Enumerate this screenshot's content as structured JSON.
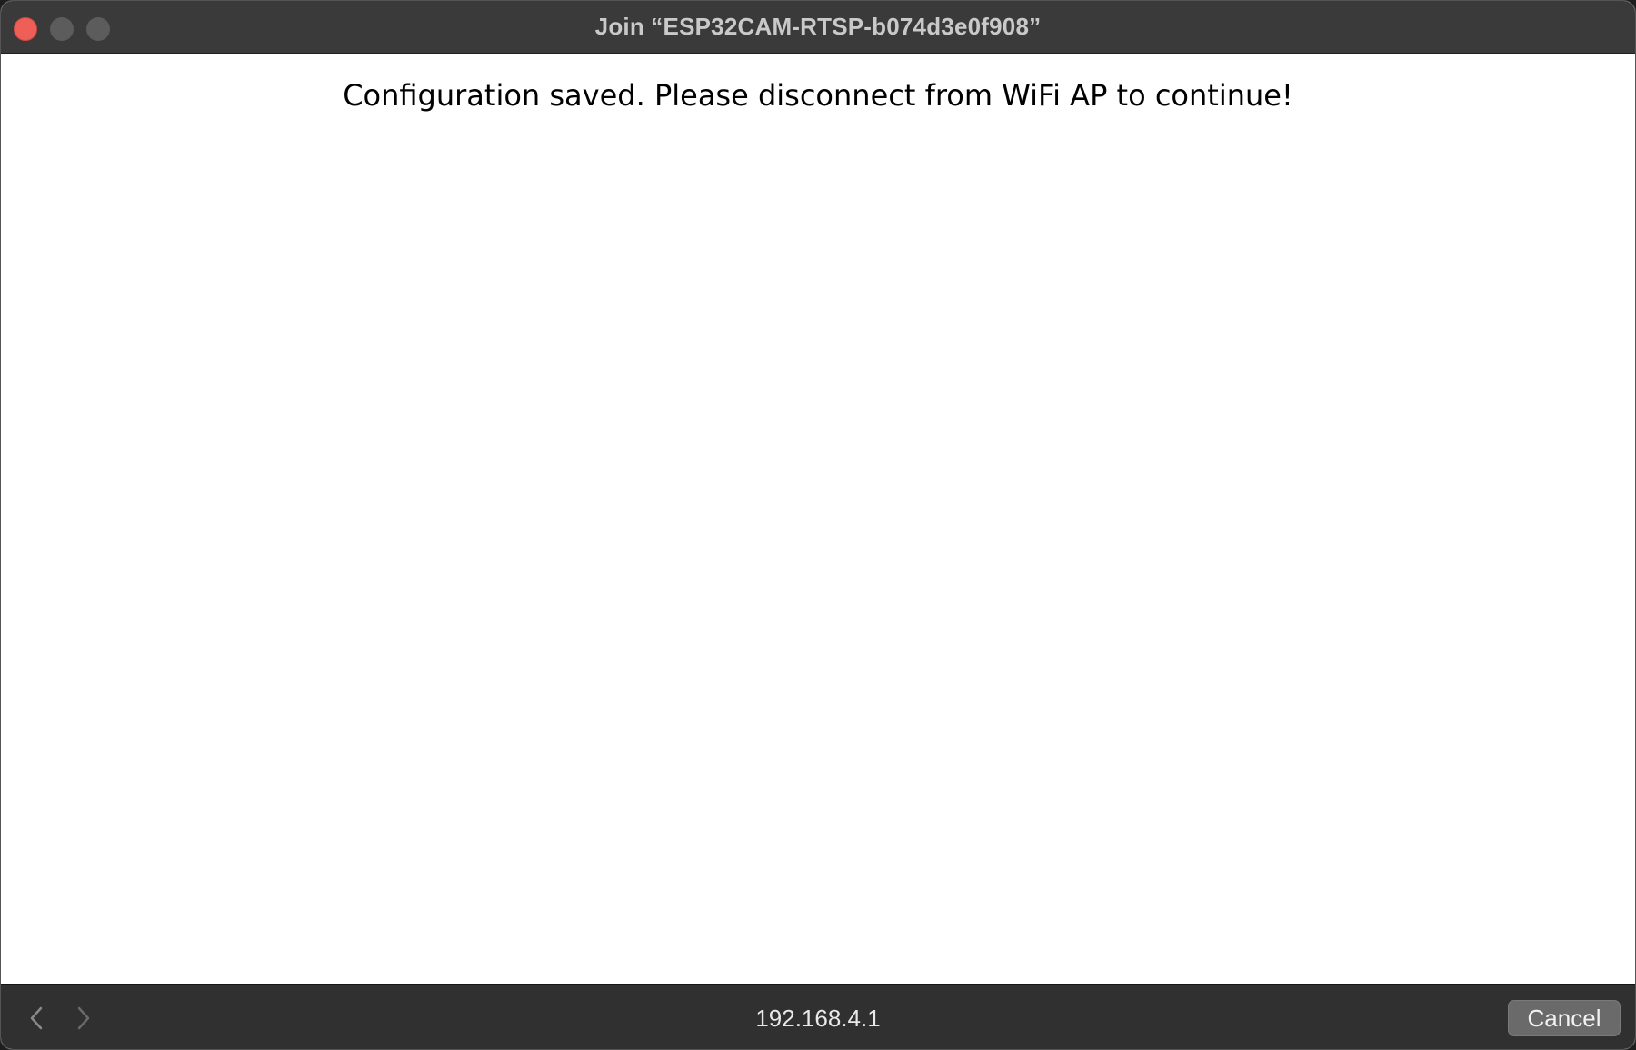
{
  "window": {
    "title": "Join “ESP32CAM-RTSP-b074d3e0f908”"
  },
  "content": {
    "message": "Configuration saved. Please disconnect from WiFi AP to continue!"
  },
  "bottombar": {
    "url": "192.168.4.1",
    "cancel_label": "Cancel"
  },
  "icons": {
    "back": "chevron-left-icon",
    "forward": "chevron-right-icon"
  },
  "colors": {
    "close_button": "#ee5f57",
    "titlebar": "#3a3a3a",
    "bottombar": "#303030",
    "content_background": "#ffffff"
  }
}
